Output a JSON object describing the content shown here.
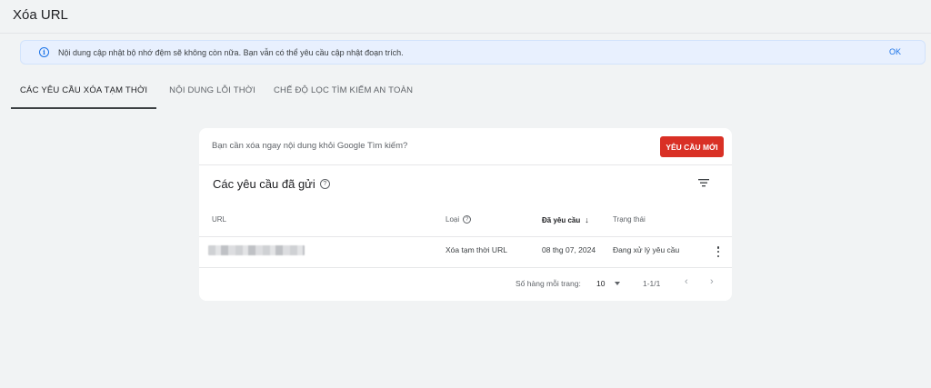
{
  "header": {
    "title": "Xóa URL"
  },
  "banner": {
    "icon": "info-icon",
    "message": "Nội dung cập nhật bộ nhớ đệm sẽ không còn nữa. Bạn vẫn có thể yêu cầu cập nhật đoạn trích.",
    "ok_label": "OK"
  },
  "tabs": [
    {
      "label": "CÁC YÊU CẦU XÓA TẠM THỜI",
      "active": true
    },
    {
      "label": "NỘI DUNG LỖI THỜI",
      "active": false
    },
    {
      "label": "CHẾ ĐỘ LỌC TÌM KIẾM AN TOÀN",
      "active": false
    }
  ],
  "card": {
    "question": "Bạn cần xóa ngay nội dung khỏi Google Tìm kiếm?",
    "new_request_label": "YÊU CẦU MỚI",
    "section_title": "Các yêu cầu đã gửi",
    "columns": {
      "url": "URL",
      "type": "Loại",
      "requested": "Đã yêu cầu",
      "status": "Trạng thái"
    },
    "rows": [
      {
        "type": "Xóa tạm thời URL",
        "requested": "08 thg 07, 2024",
        "status": "Đang xử lý yêu cầu"
      }
    ],
    "pagination": {
      "rows_per_page_label": "Số hàng mỗi trang:",
      "rows_per_page_value": "10",
      "range": "1-1/1",
      "prev": "‹",
      "next": "›"
    }
  },
  "colors": {
    "accent": "#1a73e8",
    "danger": "#d93025",
    "background": "#f1f3f4"
  }
}
